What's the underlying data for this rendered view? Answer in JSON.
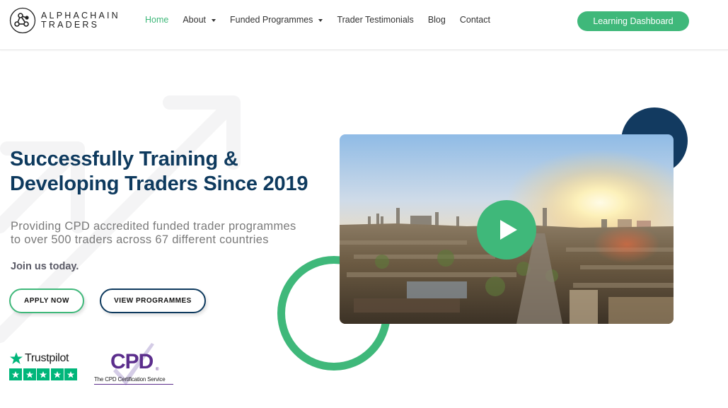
{
  "header": {
    "logo": {
      "line1": "ALPHACHAIN",
      "line2": "TRADERS",
      "icon": "network-nodes-icon"
    },
    "nav": [
      {
        "label": "Home",
        "active": true,
        "has_dropdown": false
      },
      {
        "label": "About",
        "active": false,
        "has_dropdown": true
      },
      {
        "label": "Funded Programmes",
        "active": false,
        "has_dropdown": true
      },
      {
        "label": "Trader Testimonials",
        "active": false,
        "has_dropdown": false
      },
      {
        "label": "Blog",
        "active": false,
        "has_dropdown": false
      },
      {
        "label": "Contact",
        "active": false,
        "has_dropdown": false
      }
    ],
    "cta_label": "Learning Dashboard"
  },
  "hero": {
    "title_line1": "Successfully Training &",
    "title_line2": "Developing Traders Since 2019",
    "subtitle_line1": "Providing CPD accredited funded trader programmes",
    "subtitle_line2": "to over 500 traders across 67 different countries",
    "join_text": "Join us today.",
    "apply_label": "APPLY NOW",
    "view_label": "VIEW PROGRAMMES"
  },
  "badges": {
    "trustpilot": {
      "name": "Trustpilot",
      "stars": 5,
      "icon": "star-icon"
    },
    "cpd": {
      "letters": "CPD",
      "registered": "®",
      "caption": "The CPD Certification Service"
    }
  },
  "video": {
    "description": "Aerial city skyline at sunset",
    "play_icon": "play-icon"
  },
  "colors": {
    "brand_green": "#3fb87a",
    "brand_navy": "#0e3a5e",
    "trustpilot_green": "#00b67a",
    "cpd_purple": "#5b2d8c"
  }
}
